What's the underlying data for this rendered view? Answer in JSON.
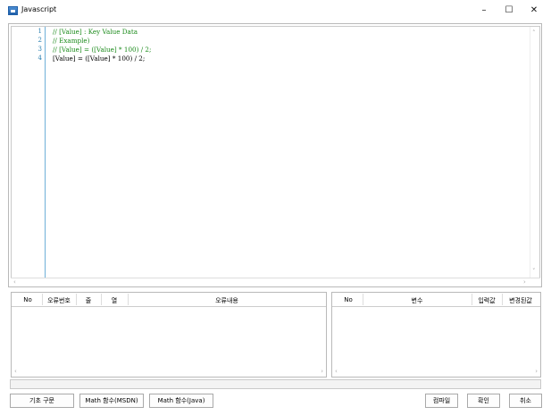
{
  "window": {
    "title": "Javascript",
    "minimize": "–",
    "maximize": "☐",
    "close": "✕"
  },
  "editor": {
    "lines": [
      {
        "num": "1",
        "text": "// [Value] : Key Value Data",
        "comment": true
      },
      {
        "num": "2",
        "text": "// Example)",
        "comment": true
      },
      {
        "num": "3",
        "text": "// [Value] = ([Value] * 100) / 2;",
        "comment": true
      },
      {
        "num": "4",
        "text": "[Value] = ([Value] * 100) / 2;",
        "comment": false
      }
    ]
  },
  "error_table": {
    "headers": [
      "No",
      "오류번호",
      "줄",
      "열",
      "오류내용"
    ]
  },
  "variable_table": {
    "headers": [
      "No",
      "변수",
      "입력값",
      "변경된값"
    ]
  },
  "buttons": {
    "basic_syntax": "기초 구문",
    "math_msdn": "Math 함수(MSDN)",
    "math_java": "Math 함수(Java)",
    "compile": "컴파일",
    "ok": "확인",
    "cancel": "취소"
  },
  "colors": {
    "comment": "#1a8a1a",
    "line_number": "#2a7fb0",
    "gutter_line": "#6fb0d8"
  }
}
